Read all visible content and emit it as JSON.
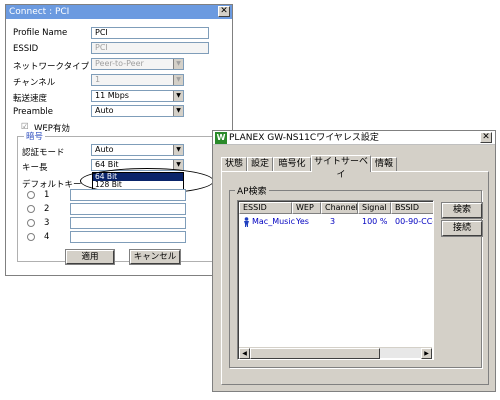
{
  "connect_window": {
    "title": "Connect : PCI",
    "close_glyph": "✕",
    "profile_name": {
      "label": "Profile Name",
      "value": "PCI"
    },
    "essid": {
      "label": "ESSID",
      "value": "PCI"
    },
    "network_type": {
      "label": "ネットワークタイプ",
      "value": "Peer-to-Peer"
    },
    "channel": {
      "label": "チャンネル",
      "value": "1"
    },
    "tx_rate": {
      "label": "転送速度",
      "value": "11 Mbps"
    },
    "preamble": {
      "label": "Preamble",
      "value": "Auto"
    },
    "wep_enable": {
      "label": "WEP有効",
      "check_glyph": "☑"
    },
    "encryption_group": {
      "title": "暗号",
      "auth_mode": {
        "label": "認証モード",
        "value": "Auto"
      },
      "key_length": {
        "label": "キー長",
        "value": "64 Bit",
        "options": [
          "64 Bit",
          "128 Bit"
        ]
      },
      "default_key": {
        "label": "デフォルトキー"
      },
      "keys": [
        "1",
        "2",
        "3",
        "4"
      ]
    },
    "apply_button": "適用",
    "cancel_button": "キャンセル",
    "dropdown_glyph": "▼"
  },
  "planex_window": {
    "logo": "W",
    "title": "PLANEX GW-NS11Cワイヤレス設定",
    "close_glyph": "✕",
    "tabs": [
      "状態",
      "設定",
      "暗号化",
      "サイトサーベイ",
      "情報"
    ],
    "active_tab": "サイトサーベイ",
    "ap_group_title": "AP検索",
    "columns": [
      "ESSID",
      "WEP",
      "Channel",
      "Signal",
      "BSSID"
    ],
    "rows": [
      {
        "icon": "person-icon",
        "essid": "Mac_Music",
        "wep": "Yes",
        "channel": "3",
        "signal": "100 %",
        "bssid": "00-90-CC-"
      }
    ],
    "search_button": "検索",
    "connect_button": "接続",
    "scroll_left_glyph": "◀",
    "scroll_right_glyph": "▶"
  }
}
